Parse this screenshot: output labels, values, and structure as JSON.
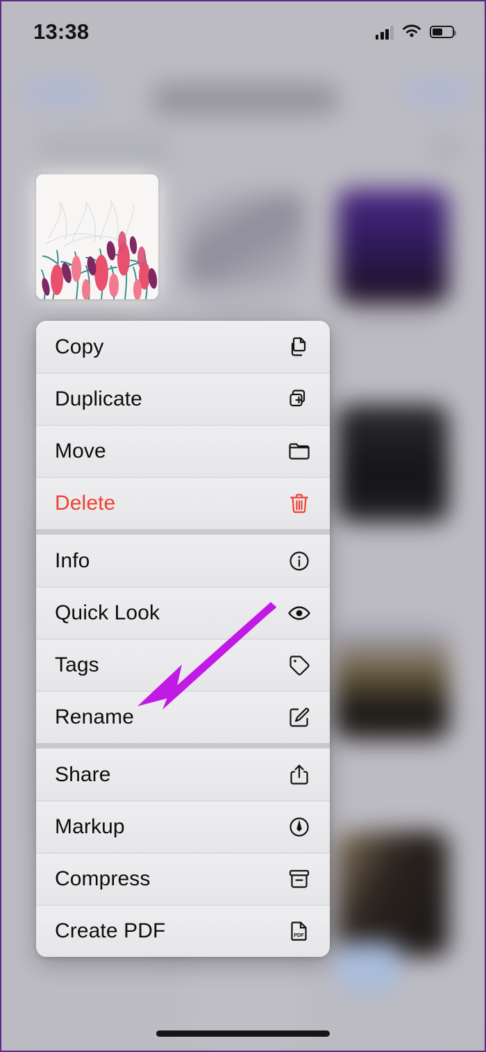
{
  "status_bar": {
    "time": "13:38",
    "icons": [
      "cellular-signal-icon",
      "wifi-icon",
      "battery-icon"
    ],
    "battery_level_percent": 53
  },
  "background": {
    "description": "Blurred iOS Files app grid behind the context menu",
    "nav_left_label": "",
    "nav_title_label": "",
    "nav_right_label": ""
  },
  "selected_item": {
    "name": "floral-illustration-thumbnail",
    "description": "Floral illustration with pink and magenta flowers on teal stems over a white background"
  },
  "context_menu": {
    "groups": [
      {
        "items": [
          {
            "label": "Copy",
            "icon": "doc-on-doc-icon",
            "destructive": false
          },
          {
            "label": "Duplicate",
            "icon": "plus-square-on-square-icon",
            "destructive": false
          },
          {
            "label": "Move",
            "icon": "folder-icon",
            "destructive": false
          },
          {
            "label": "Delete",
            "icon": "trash-icon",
            "destructive": true
          }
        ]
      },
      {
        "items": [
          {
            "label": "Info",
            "icon": "info-circle-icon",
            "destructive": false
          },
          {
            "label": "Quick Look",
            "icon": "eye-icon",
            "destructive": false
          },
          {
            "label": "Tags",
            "icon": "tag-icon",
            "destructive": false
          },
          {
            "label": "Rename",
            "icon": "pencil-square-icon",
            "destructive": false
          }
        ]
      },
      {
        "items": [
          {
            "label": "Share",
            "icon": "share-up-arrow-icon",
            "destructive": false
          },
          {
            "label": "Markup",
            "icon": "pen-circle-icon",
            "destructive": false
          },
          {
            "label": "Compress",
            "icon": "archivebox-icon",
            "destructive": false
          },
          {
            "label": "Create PDF",
            "icon": "doc-pdf-icon",
            "destructive": false
          }
        ]
      }
    ]
  },
  "annotation": {
    "type": "arrow",
    "color": "#c11ae6",
    "points_to": "Rename"
  },
  "colors": {
    "destructive": "#f04031",
    "menu_background": "#e8e8eb",
    "separator": "#c9c9ce",
    "screen_background": "#bbbac1",
    "frame_border": "#5b2a86"
  },
  "home_indicator": {
    "visible": true
  }
}
